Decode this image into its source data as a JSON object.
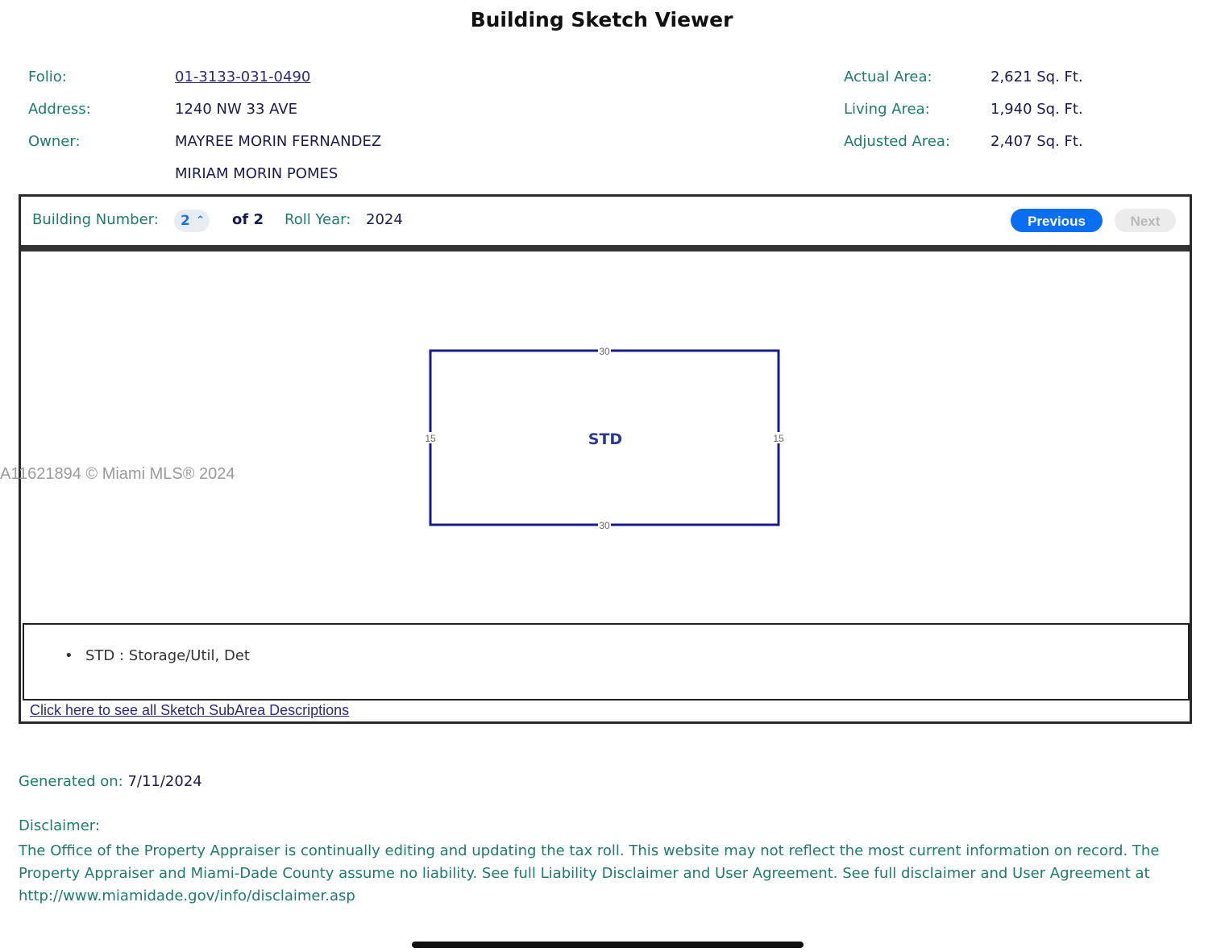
{
  "title": "Building Sketch Viewer",
  "info": {
    "folio_label": "Folio:",
    "folio_value": "01-3133-031-0490",
    "address_label": "Address:",
    "address_value": "1240 NW 33 AVE",
    "owner_label": "Owner:",
    "owner_value_1": "MAYREE MORIN FERNANDEZ",
    "owner_value_2": "MIRIAM MORIN POMES",
    "actual_area_label": "Actual Area:",
    "actual_area_value": "2,621 Sq. Ft.",
    "living_area_label": "Living Area:",
    "living_area_value": "1,940 Sq. Ft.",
    "adjusted_area_label": "Adjusted Area:",
    "adjusted_area_value": "2,407 Sq. Ft."
  },
  "toolbar": {
    "building_number_label": "Building Number:",
    "building_number_value": "2",
    "of_label": "of 2",
    "roll_year_label": "Roll Year:",
    "roll_year_value": "2024",
    "previous_label": "Previous",
    "next_label": "Next"
  },
  "sketch": {
    "label": "STD",
    "top_dim": "30",
    "bottom_dim": "30",
    "left_dim": "15",
    "right_dim": "15",
    "outline_color": "#1a1a8c"
  },
  "legend": {
    "items": [
      {
        "bullet": "•",
        "text": "STD : Storage/Util, Det"
      }
    ]
  },
  "subarea_link": "Click here to see all Sketch SubArea Descriptions",
  "watermark": "A11621894 © Miami MLS® 2024",
  "generated": {
    "label": "Generated on:",
    "value": "7/11/2024"
  },
  "disclaimer": {
    "label": "Disclaimer:",
    "text": "The Office of the Property Appraiser is continually editing and updating the tax roll. This website may not reflect the most current information on record. The Property Appraiser and Miami-Dade County assume no liability. See full Liability Disclaimer and User Agreement. See full disclaimer and User Agreement at http://www.miamidade.gov/info/disclaimer.asp"
  }
}
